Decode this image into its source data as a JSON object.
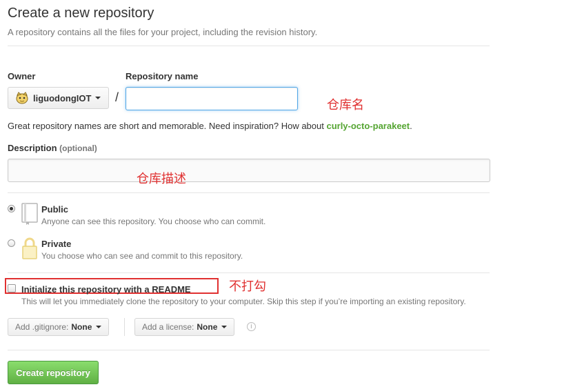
{
  "header": {
    "title": "Create a new repository",
    "subtitle": "A repository contains all the files for your project, including the revision history."
  },
  "owner": {
    "label": "Owner",
    "value": "liguodongIOT",
    "avatar_icon": "octocat-avatar"
  },
  "repo_name": {
    "label": "Repository name",
    "separator": "/",
    "value": "",
    "annotation": "仓库名"
  },
  "hint": {
    "text": "Great repository names are short and memorable. Need inspiration? How about ",
    "suggestion": "curly-octo-parakeet",
    "end": "."
  },
  "description": {
    "label": "Description",
    "optional": "(optional)",
    "value": "",
    "annotation": "仓库描述"
  },
  "visibility": {
    "selected": "public",
    "public": {
      "title": "Public",
      "desc": "Anyone can see this repository. You choose who can commit.",
      "icon": "book-icon"
    },
    "private": {
      "title": "Private",
      "desc": "You choose who can see and commit to this repository.",
      "icon": "lock-icon"
    }
  },
  "init_readme": {
    "checked": false,
    "label": "Initialize this repository with a README",
    "desc": "This will let you immediately clone the repository to your computer. Skip this step if you’re importing an existing repository.",
    "annotation": "不打勾"
  },
  "gitignore": {
    "label": "Add .gitignore:",
    "value": "None"
  },
  "license": {
    "label": "Add a license:",
    "value": "None"
  },
  "submit": {
    "label": "Create repository"
  },
  "colors": {
    "accent_green": "#55a532",
    "button_green": "#60b044",
    "annotation_red": "#e03030",
    "focus_blue": "#51a7e8"
  }
}
